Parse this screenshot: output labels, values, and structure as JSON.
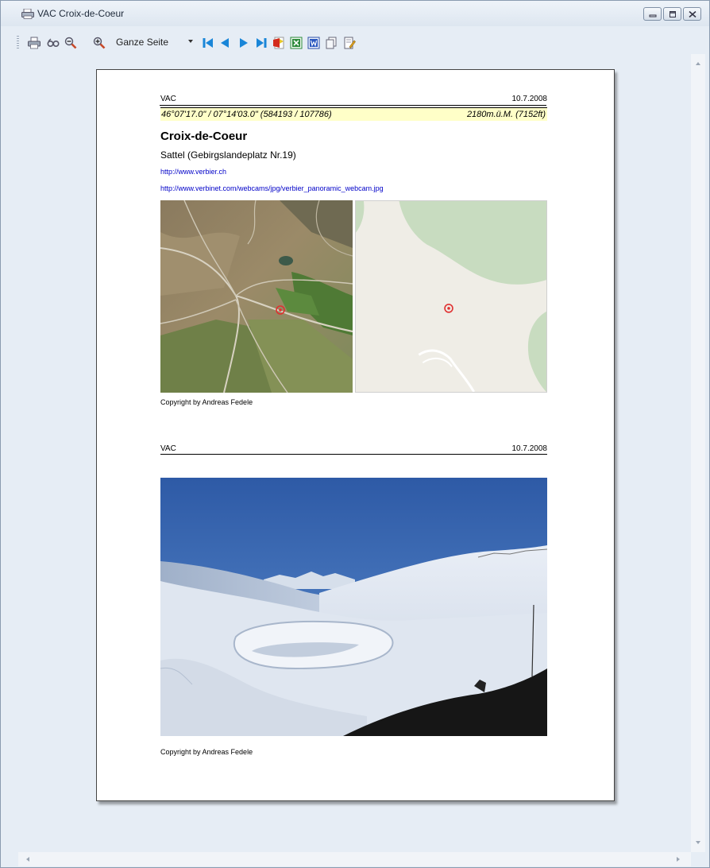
{
  "window": {
    "title": "VAC Croix-de-Coeur",
    "buttons": [
      "minimize",
      "maximize",
      "close"
    ]
  },
  "toolbar": {
    "icons": [
      "print-icon",
      "page-setup-icon",
      "zoom-out-icon",
      "zoom-in-icon",
      "first-page-icon",
      "previous-page-icon",
      "next-page-icon",
      "last-page-icon",
      "pdf-export-icon",
      "excel-export-icon",
      "word-export-icon",
      "copy-icon",
      "edit-icon"
    ],
    "zoom_value": "Ganze Seite"
  },
  "page1": {
    "header_left": "VAC",
    "header_right": "10.7.2008",
    "coords_left": "46°07'17.0\" / 07°14'03.0\" (584193 / 107786)",
    "coords_right": "2180m.ü.M. (7152ft)",
    "title": "Croix-de-Coeur",
    "subtitle": "Sattel (Gebirgslandeplatz Nr.19)",
    "link1": "http://www.verbier.ch",
    "link2": "http://www.verbinet.com/webcams/jpg/verbier_panoramic_webcam.jpg",
    "copyright": "Copyright by Andreas Fedele"
  },
  "page2": {
    "header_left": "VAC",
    "header_right": "10.7.2008",
    "copyright": "Copyright by Andreas Fedele"
  },
  "colors": {
    "coords_background": "#ffffc8",
    "link": "#0000c8",
    "helipad_marker": "#e03030"
  }
}
